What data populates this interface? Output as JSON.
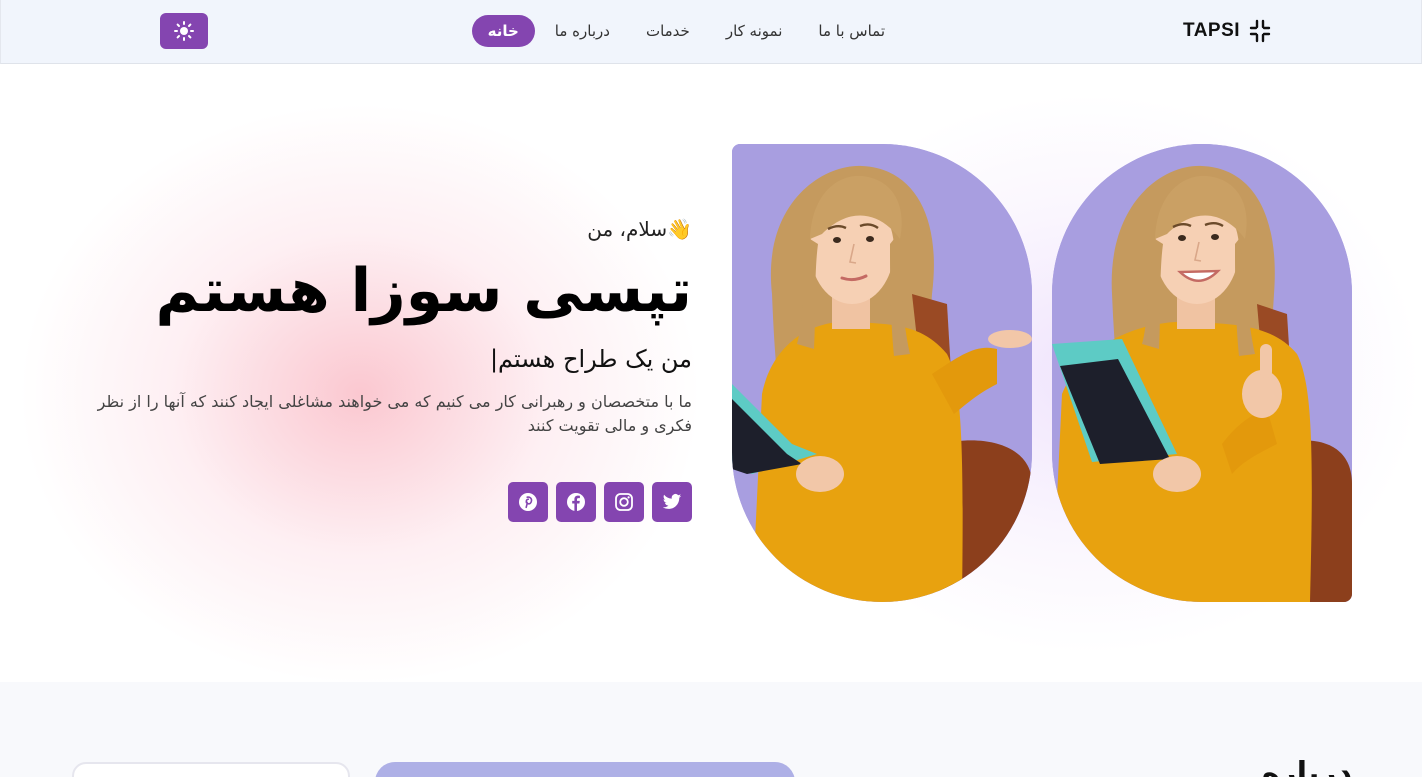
{
  "navbar": {
    "brand": "TAPSI",
    "links": [
      {
        "label": "خانه",
        "active": true
      },
      {
        "label": "درباره ما",
        "active": false
      },
      {
        "label": "خدمات",
        "active": false
      },
      {
        "label": "نمونه کار",
        "active": false
      },
      {
        "label": "تماس با ما",
        "active": false
      }
    ],
    "theme_toggle_icon": "sun-icon"
  },
  "hero": {
    "greeting": "👋سلام، من",
    "title": "تپسی سوزا هستم",
    "subtitle": "من یک طراح هستم|",
    "description": "ما با متخصصان و رهبرانی کار می کنیم که می خواهند مشاغلی ایجاد کنند که آنها را از نظر فکری و مالی تقویت کنند",
    "socials": [
      "pinterest-icon",
      "facebook-icon",
      "instagram-icon",
      "twitter-icon"
    ],
    "photos": [
      "woman-shrugging-photo",
      "woman-thumbs-up-photo"
    ]
  },
  "section2": {
    "title": "درباره"
  },
  "colors": {
    "accent": "#8445b0",
    "nav_bg": "#f1f5fc",
    "photo_bg": "#a89ee0",
    "sweater": "#e8a20f"
  }
}
